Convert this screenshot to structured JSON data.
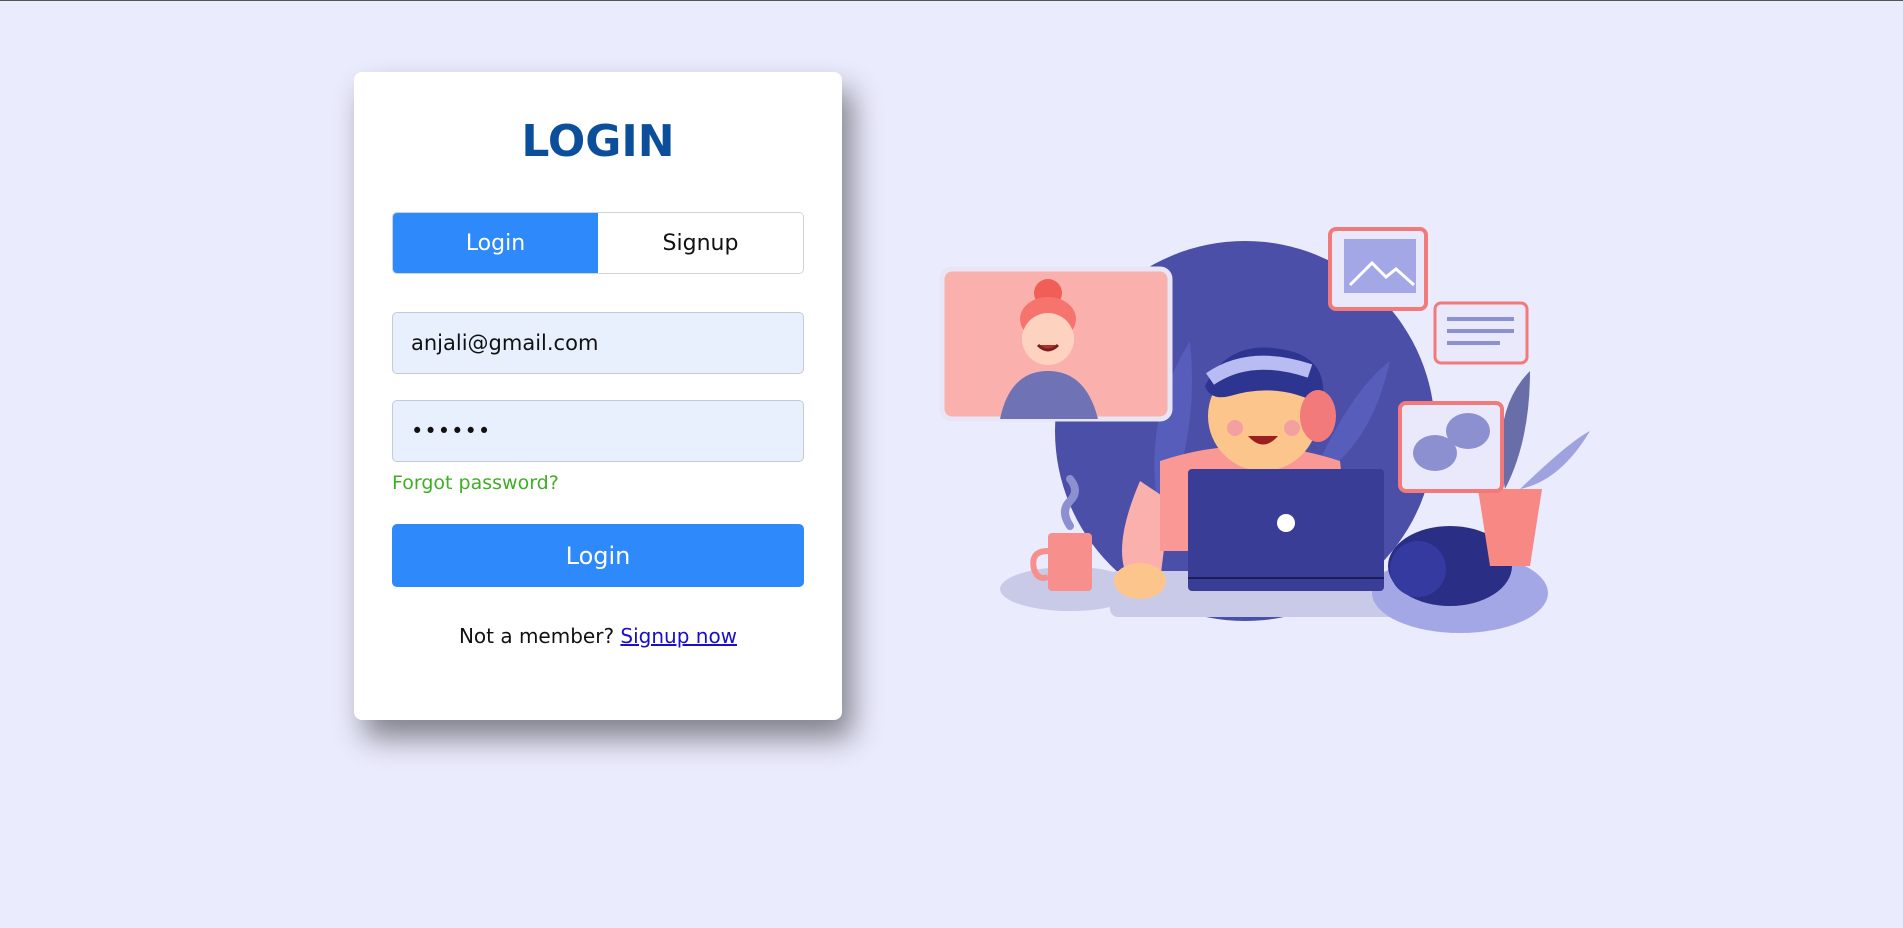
{
  "login_card": {
    "title": "LOGIN",
    "tabs": [
      {
        "label": "Login",
        "active": true
      },
      {
        "label": "Signup",
        "active": false
      }
    ],
    "email_value": "anjali@gmail.com",
    "password_value": "••••••",
    "forgot_label": "Forgot password?",
    "submit_label": "Login",
    "not_member_text": "Not a member? ",
    "signup_link_label": "Signup now"
  },
  "colors": {
    "background": "#eaebfd",
    "accent": "#2e89fb",
    "title": "#0b4f9c",
    "forgot": "#3fae23",
    "link": "#1a0dcc"
  },
  "illustration": {
    "icons": [
      "video-call-icon",
      "image-icon",
      "text-lines-icon",
      "chat-bubbles-icon"
    ]
  }
}
